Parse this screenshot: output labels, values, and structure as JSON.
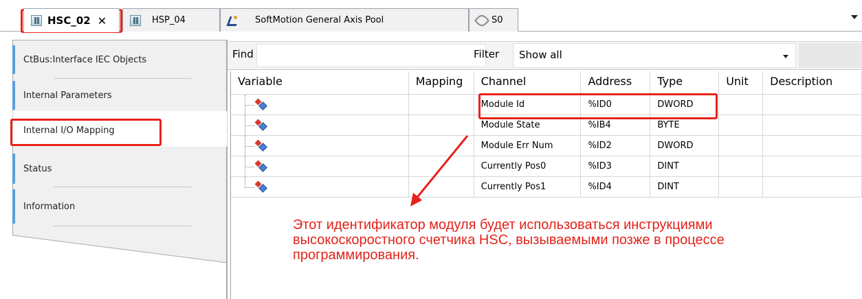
{
  "tabs": [
    {
      "label": "HSC_02",
      "icon": "device-module-icon",
      "active": true,
      "close": "✕"
    },
    {
      "label": "HSP_04",
      "icon": "device-module-icon",
      "active": false
    },
    {
      "label": "SoftMotion General Axis Pool",
      "icon": "axis-pool-icon",
      "active": false
    },
    {
      "label": "S0",
      "icon": "s-curve-icon",
      "active": false
    }
  ],
  "sidebar": {
    "items": [
      {
        "label": "CtBus:Interface IEC Objects"
      },
      {
        "label": "Internal Parameters"
      },
      {
        "label": "Internal I/O Mapping",
        "selected": true
      },
      {
        "label": "Status"
      },
      {
        "label": "Information"
      }
    ]
  },
  "toolbar": {
    "find_label": "Find",
    "find_value": "",
    "filter_label": "Filter",
    "filter_value": "Show all"
  },
  "table": {
    "columns": [
      "Variable",
      "Mapping",
      "Channel",
      "Address",
      "Type",
      "Unit",
      "Description"
    ],
    "rows": [
      {
        "variable": "",
        "mapping": "",
        "channel": "Module Id",
        "address": "%ID0",
        "type": "DWORD",
        "unit": "",
        "description": ""
      },
      {
        "variable": "",
        "mapping": "",
        "channel": "Module State",
        "address": "%IB4",
        "type": "BYTE",
        "unit": "",
        "description": ""
      },
      {
        "variable": "",
        "mapping": "",
        "channel": "Module Err Num",
        "address": "%ID2",
        "type": "DWORD",
        "unit": "",
        "description": ""
      },
      {
        "variable": "",
        "mapping": "",
        "channel": "Currently Pos0",
        "address": "%ID3",
        "type": "DINT",
        "unit": "",
        "description": ""
      },
      {
        "variable": "",
        "mapping": "",
        "channel": "Currently Pos1",
        "address": "%ID4",
        "type": "DINT",
        "unit": "",
        "description": ""
      }
    ]
  },
  "annotation": {
    "color": "#e2231a",
    "lines": [
      "Этот идентификатор модуля будет использоваться инструкциями",
      "высокоскоростного счетчика HSC, вызываемыми позже в процессе",
      "программирования."
    ]
  }
}
